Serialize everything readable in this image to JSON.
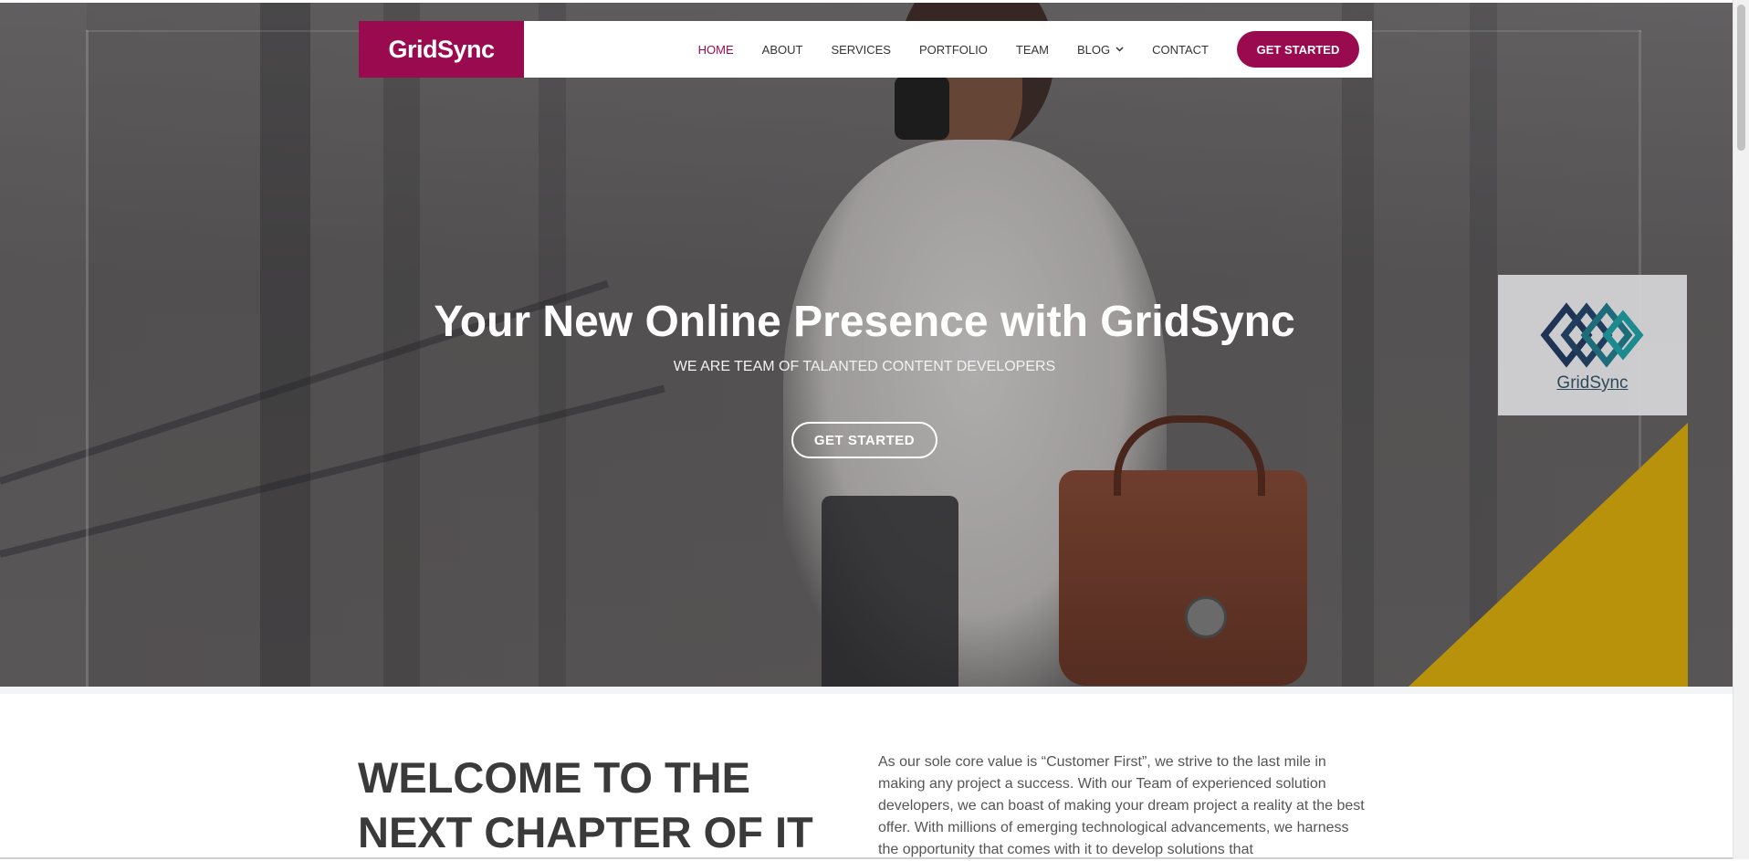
{
  "brand": {
    "name": "GridSync",
    "color": "#9a0a4f"
  },
  "nav": {
    "items": [
      {
        "label": "HOME",
        "active": true
      },
      {
        "label": "ABOUT"
      },
      {
        "label": "SERVICES"
      },
      {
        "label": "PORTFOLIO"
      },
      {
        "label": "TEAM"
      },
      {
        "label": "BLOG",
        "has_dropdown": true,
        "icon": "chevron-down-icon"
      },
      {
        "label": "CONTACT"
      }
    ],
    "cta_label": "GET STARTED"
  },
  "hero": {
    "title": "Your New Online Presence with GridSync",
    "subtitle": "WE ARE TEAM OF TALANTED CONTENT DEVELOPERS",
    "cta_label": "GET STARTED",
    "badge": {
      "logo_text": "GridSync",
      "accent": "#d4a200"
    }
  },
  "welcome": {
    "heading_line1": "WELCOME TO THE",
    "heading_line2": "NEXT CHAPTER OF IT",
    "paragraph": "As our sole core value is “Customer First”, we strive to the last mile in making any project a success. With our Team of experienced solution developers, we can boast of making your dream project a reality at the best offer. With millions of emerging technological advancements, we harness the opportunity that comes with it to develop solutions that"
  }
}
